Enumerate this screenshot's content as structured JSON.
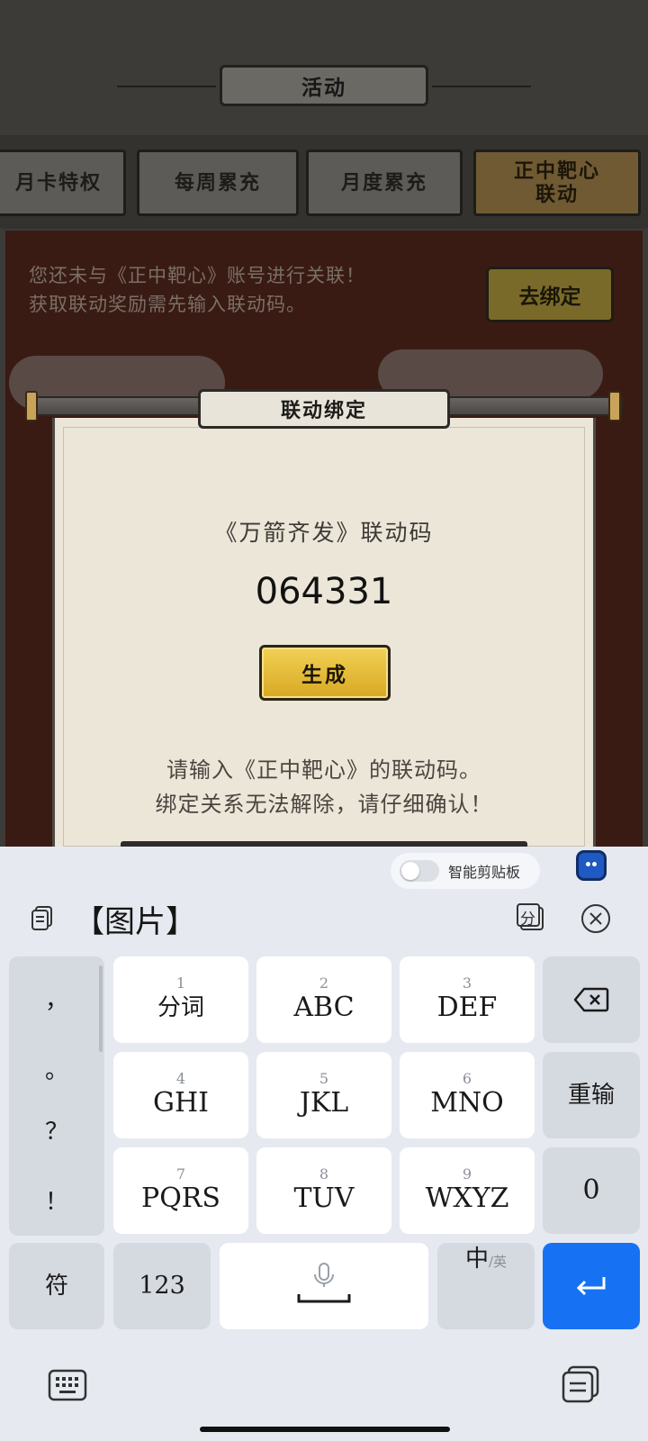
{
  "game": {
    "section_title": "活动",
    "tabs": [
      {
        "label": "月卡特权"
      },
      {
        "label": "每周累充"
      },
      {
        "label": "月度累充"
      },
      {
        "label": "正中靶心\n联动"
      }
    ],
    "notice_line1": "您还未与《正中靶心》账号进行关联！",
    "notice_line2": "获取联动奖励需先输入联动码。",
    "bind_button": "去绑定"
  },
  "dialog": {
    "title": "联动绑定",
    "code_label": "《万箭齐发》联动码",
    "code_value": "064331",
    "generate_button": "生成",
    "instruction_line1": "请输入《正中靶心》的联动码。",
    "instruction_line2": "绑定关系无法解除，请仔细确认！"
  },
  "keyboard": {
    "clipboard_label": "智能剪贴板",
    "candidate_text": "【图片】",
    "split_label": "分",
    "punctuation": [
      "，",
      "。",
      "？",
      "！"
    ],
    "keys": [
      {
        "num": "1",
        "label": "分词"
      },
      {
        "num": "2",
        "label": "ABC"
      },
      {
        "num": "3",
        "label": "DEF"
      },
      {
        "num": "4",
        "label": "GHI"
      },
      {
        "num": "5",
        "label": "JKL"
      },
      {
        "num": "6",
        "label": "MNO"
      },
      {
        "num": "7",
        "label": "PQRS"
      },
      {
        "num": "8",
        "label": "TUV"
      },
      {
        "num": "9",
        "label": "WXYZ"
      }
    ],
    "reinput_label": "重输",
    "zero_label": "0",
    "symbol_label": "符",
    "numeric_label": "123",
    "lang_main": "中",
    "lang_sub": "/英"
  }
}
